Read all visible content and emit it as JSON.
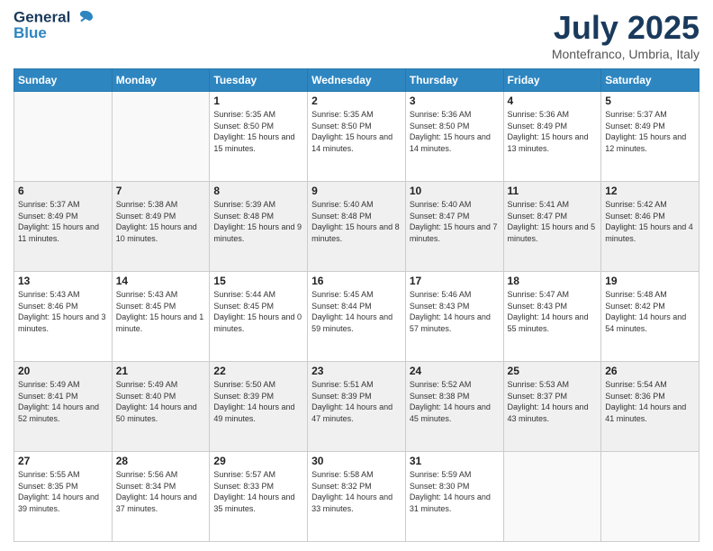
{
  "header": {
    "logo_line1": "General",
    "logo_line2": "Blue",
    "month_title": "July 2025",
    "location": "Montefranco, Umbria, Italy"
  },
  "days_of_week": [
    "Sunday",
    "Monday",
    "Tuesday",
    "Wednesday",
    "Thursday",
    "Friday",
    "Saturday"
  ],
  "weeks": [
    [
      {
        "day": "",
        "sunrise": "",
        "sunset": "",
        "daylight": ""
      },
      {
        "day": "",
        "sunrise": "",
        "sunset": "",
        "daylight": ""
      },
      {
        "day": "1",
        "sunrise": "Sunrise: 5:35 AM",
        "sunset": "Sunset: 8:50 PM",
        "daylight": "Daylight: 15 hours and 15 minutes."
      },
      {
        "day": "2",
        "sunrise": "Sunrise: 5:35 AM",
        "sunset": "Sunset: 8:50 PM",
        "daylight": "Daylight: 15 hours and 14 minutes."
      },
      {
        "day": "3",
        "sunrise": "Sunrise: 5:36 AM",
        "sunset": "Sunset: 8:50 PM",
        "daylight": "Daylight: 15 hours and 14 minutes."
      },
      {
        "day": "4",
        "sunrise": "Sunrise: 5:36 AM",
        "sunset": "Sunset: 8:49 PM",
        "daylight": "Daylight: 15 hours and 13 minutes."
      },
      {
        "day": "5",
        "sunrise": "Sunrise: 5:37 AM",
        "sunset": "Sunset: 8:49 PM",
        "daylight": "Daylight: 15 hours and 12 minutes."
      }
    ],
    [
      {
        "day": "6",
        "sunrise": "Sunrise: 5:37 AM",
        "sunset": "Sunset: 8:49 PM",
        "daylight": "Daylight: 15 hours and 11 minutes."
      },
      {
        "day": "7",
        "sunrise": "Sunrise: 5:38 AM",
        "sunset": "Sunset: 8:49 PM",
        "daylight": "Daylight: 15 hours and 10 minutes."
      },
      {
        "day": "8",
        "sunrise": "Sunrise: 5:39 AM",
        "sunset": "Sunset: 8:48 PM",
        "daylight": "Daylight: 15 hours and 9 minutes."
      },
      {
        "day": "9",
        "sunrise": "Sunrise: 5:40 AM",
        "sunset": "Sunset: 8:48 PM",
        "daylight": "Daylight: 15 hours and 8 minutes."
      },
      {
        "day": "10",
        "sunrise": "Sunrise: 5:40 AM",
        "sunset": "Sunset: 8:47 PM",
        "daylight": "Daylight: 15 hours and 7 minutes."
      },
      {
        "day": "11",
        "sunrise": "Sunrise: 5:41 AM",
        "sunset": "Sunset: 8:47 PM",
        "daylight": "Daylight: 15 hours and 5 minutes."
      },
      {
        "day": "12",
        "sunrise": "Sunrise: 5:42 AM",
        "sunset": "Sunset: 8:46 PM",
        "daylight": "Daylight: 15 hours and 4 minutes."
      }
    ],
    [
      {
        "day": "13",
        "sunrise": "Sunrise: 5:43 AM",
        "sunset": "Sunset: 8:46 PM",
        "daylight": "Daylight: 15 hours and 3 minutes."
      },
      {
        "day": "14",
        "sunrise": "Sunrise: 5:43 AM",
        "sunset": "Sunset: 8:45 PM",
        "daylight": "Daylight: 15 hours and 1 minute."
      },
      {
        "day": "15",
        "sunrise": "Sunrise: 5:44 AM",
        "sunset": "Sunset: 8:45 PM",
        "daylight": "Daylight: 15 hours and 0 minutes."
      },
      {
        "day": "16",
        "sunrise": "Sunrise: 5:45 AM",
        "sunset": "Sunset: 8:44 PM",
        "daylight": "Daylight: 14 hours and 59 minutes."
      },
      {
        "day": "17",
        "sunrise": "Sunrise: 5:46 AM",
        "sunset": "Sunset: 8:43 PM",
        "daylight": "Daylight: 14 hours and 57 minutes."
      },
      {
        "day": "18",
        "sunrise": "Sunrise: 5:47 AM",
        "sunset": "Sunset: 8:43 PM",
        "daylight": "Daylight: 14 hours and 55 minutes."
      },
      {
        "day": "19",
        "sunrise": "Sunrise: 5:48 AM",
        "sunset": "Sunset: 8:42 PM",
        "daylight": "Daylight: 14 hours and 54 minutes."
      }
    ],
    [
      {
        "day": "20",
        "sunrise": "Sunrise: 5:49 AM",
        "sunset": "Sunset: 8:41 PM",
        "daylight": "Daylight: 14 hours and 52 minutes."
      },
      {
        "day": "21",
        "sunrise": "Sunrise: 5:49 AM",
        "sunset": "Sunset: 8:40 PM",
        "daylight": "Daylight: 14 hours and 50 minutes."
      },
      {
        "day": "22",
        "sunrise": "Sunrise: 5:50 AM",
        "sunset": "Sunset: 8:39 PM",
        "daylight": "Daylight: 14 hours and 49 minutes."
      },
      {
        "day": "23",
        "sunrise": "Sunrise: 5:51 AM",
        "sunset": "Sunset: 8:39 PM",
        "daylight": "Daylight: 14 hours and 47 minutes."
      },
      {
        "day": "24",
        "sunrise": "Sunrise: 5:52 AM",
        "sunset": "Sunset: 8:38 PM",
        "daylight": "Daylight: 14 hours and 45 minutes."
      },
      {
        "day": "25",
        "sunrise": "Sunrise: 5:53 AM",
        "sunset": "Sunset: 8:37 PM",
        "daylight": "Daylight: 14 hours and 43 minutes."
      },
      {
        "day": "26",
        "sunrise": "Sunrise: 5:54 AM",
        "sunset": "Sunset: 8:36 PM",
        "daylight": "Daylight: 14 hours and 41 minutes."
      }
    ],
    [
      {
        "day": "27",
        "sunrise": "Sunrise: 5:55 AM",
        "sunset": "Sunset: 8:35 PM",
        "daylight": "Daylight: 14 hours and 39 minutes."
      },
      {
        "day": "28",
        "sunrise": "Sunrise: 5:56 AM",
        "sunset": "Sunset: 8:34 PM",
        "daylight": "Daylight: 14 hours and 37 minutes."
      },
      {
        "day": "29",
        "sunrise": "Sunrise: 5:57 AM",
        "sunset": "Sunset: 8:33 PM",
        "daylight": "Daylight: 14 hours and 35 minutes."
      },
      {
        "day": "30",
        "sunrise": "Sunrise: 5:58 AM",
        "sunset": "Sunset: 8:32 PM",
        "daylight": "Daylight: 14 hours and 33 minutes."
      },
      {
        "day": "31",
        "sunrise": "Sunrise: 5:59 AM",
        "sunset": "Sunset: 8:30 PM",
        "daylight": "Daylight: 14 hours and 31 minutes."
      },
      {
        "day": "",
        "sunrise": "",
        "sunset": "",
        "daylight": ""
      },
      {
        "day": "",
        "sunrise": "",
        "sunset": "",
        "daylight": ""
      }
    ]
  ]
}
